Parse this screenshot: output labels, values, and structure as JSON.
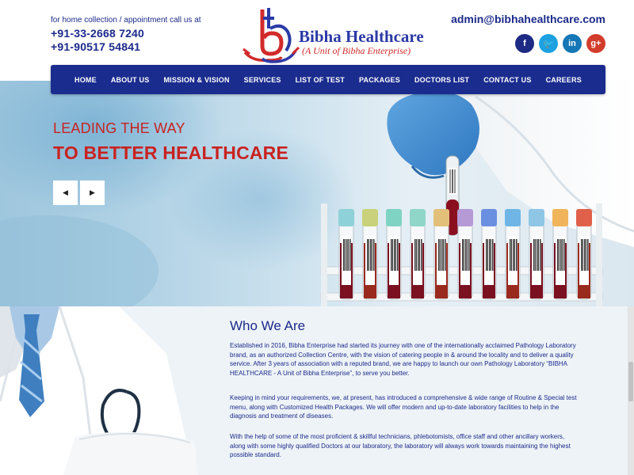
{
  "header": {
    "hint": "for home collection / appointment call us at",
    "phone1": "+91-33-2668 7240",
    "phone2": "+91-90517 54841",
    "brand": "Bibha Healthcare",
    "tagline": "(A Unit of Bibha Enterprise)",
    "email": "admin@bibhahealthcare.com",
    "socials": [
      {
        "icon": "facebook-icon",
        "glyph": "f",
        "color": "#1e2b84"
      },
      {
        "icon": "twitter-icon",
        "glyph": "🐦",
        "color": "#1da1e0"
      },
      {
        "icon": "linkedin-icon",
        "glyph": "in",
        "color": "#1577b5"
      },
      {
        "icon": "google-plus-icon",
        "glyph": "g+",
        "color": "#d23d2c"
      }
    ]
  },
  "nav": {
    "items": [
      "HOME",
      "ABOUT US",
      "MISSION & VISION",
      "SERVICES",
      "LIST OF TEST",
      "PACKAGES",
      "DOCTORS LIST",
      "CONTACT US",
      "CAREERS"
    ]
  },
  "hero": {
    "line1": "LEADING THE WAY",
    "line2": "TO BETTER HEALTHCARE",
    "prev": "◀",
    "next": "▶"
  },
  "about": {
    "title": "Who We Are",
    "p1": "Established in 2016, Bibha Enterprise had started its journey with one of the internationally acclaimed Pathology Laboratory brand, as an authorized Collection Centre, with the vision of catering people in & around the locality and to deliver a quality service. After 3 years of association with a reputed brand, we are happy to launch our own Pathology Laboratory “BIBHA HEALTHCARE - A Unit of Bibha Enterprise”, to serve you better.",
    "p2": "Keeping in mind your requirements, we, at present, has introduced a comprehensive & wide range of Routine & Special test menu, along with Customized Health Packages. We will offer modern and up-to-date laboratory facilities to help in the diagnosis and treatment of diseases.",
    "p3": "With the help of some of the most proficient & skillful technicians, phlebotomists, office staff and other ancillary workers, along with some highly qualified Doctors at our laboratory, the laboratory will always work towards maintaining the highest possible standard."
  },
  "colors": {
    "navy": "#1b2c8f",
    "accent_red": "#c9221f"
  }
}
